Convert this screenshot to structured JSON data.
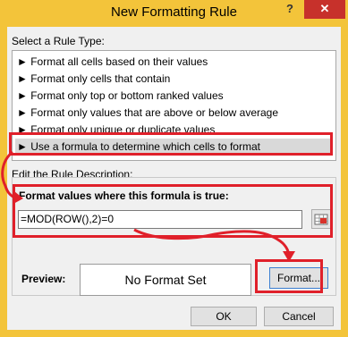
{
  "window": {
    "title": "New Formatting Rule",
    "help_icon": "?",
    "close_icon": "✕"
  },
  "rule_type": {
    "label": "Select a Rule Type:",
    "items": [
      "► Format all cells based on their values",
      "► Format only cells that contain",
      "► Format only top or bottom ranked values",
      "► Format only values that are above or below average",
      "► Format only unique or duplicate values",
      "► Use a formula to determine which cells to format"
    ],
    "selected_index": 5
  },
  "description": {
    "label": "Edit the Rule Description:",
    "formula_label": "Format values where this formula is true:",
    "formula_value": "=MOD(ROW(),2)=0",
    "collapse_icon": "range-select-icon",
    "preview_label": "Preview:",
    "preview_text": "No Format Set",
    "format_button": "Format..."
  },
  "buttons": {
    "ok": "OK",
    "cancel": "Cancel"
  },
  "colors": {
    "frame": "#f3c43a",
    "annotation_red": "#e0202a",
    "selected_row": "#d9d9d9"
  }
}
